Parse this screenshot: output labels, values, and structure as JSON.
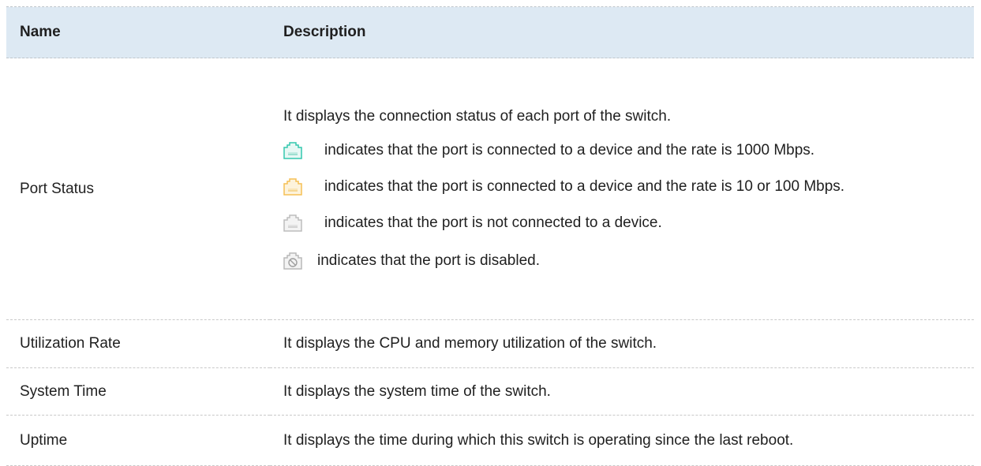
{
  "table": {
    "headers": {
      "name": "Name",
      "description": "Description"
    },
    "rows": {
      "port_status": {
        "name": "Port Status",
        "intro": "It displays the connection status of each port of the switch.",
        "items": [
          {
            "icon": "port-1000m-icon",
            "color": "#33c7ae",
            "text": "indicates that the port is connected to a device and the rate is 1000 Mbps."
          },
          {
            "icon": "port-10-100m-icon",
            "color": "#f5c055",
            "text": "indicates that the port is connected to a device and the rate is 10 or 100 Mbps."
          },
          {
            "icon": "port-disconnected-icon",
            "color": "#bdbdbd",
            "text": "indicates that the port is not connected to a device."
          },
          {
            "icon": "port-disabled-icon",
            "color": "#b9b9b9",
            "text": "indicates that the port is disabled."
          }
        ]
      },
      "utilization_rate": {
        "name": "Utilization Rate",
        "description": "It displays the CPU and memory utilization of the switch."
      },
      "system_time": {
        "name": "System Time",
        "description": "It displays the system time of the switch."
      },
      "uptime": {
        "name": "Uptime",
        "description": "It displays the time during which this switch is operating since the last reboot."
      }
    }
  }
}
